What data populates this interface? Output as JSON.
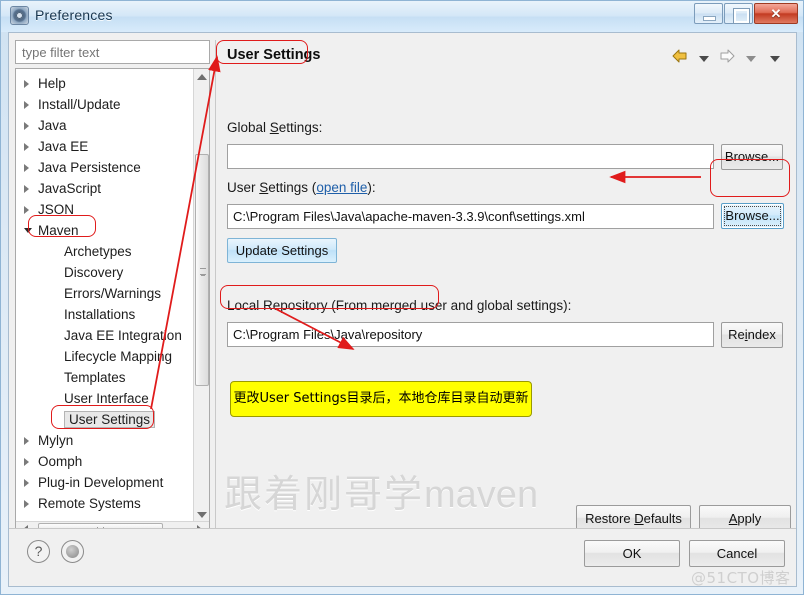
{
  "window": {
    "title": "Preferences",
    "icon": "gear-icon",
    "controls": {
      "minimize": "",
      "maximize": "",
      "close": "✕"
    }
  },
  "sidebar": {
    "filter_placeholder": "type filter text",
    "items": [
      {
        "label": "Help",
        "level": 0,
        "twisty": "closed"
      },
      {
        "label": "Install/Update",
        "level": 0,
        "twisty": "closed"
      },
      {
        "label": "Java",
        "level": 0,
        "twisty": "closed"
      },
      {
        "label": "Java EE",
        "level": 0,
        "twisty": "closed"
      },
      {
        "label": "Java Persistence",
        "level": 0,
        "twisty": "closed"
      },
      {
        "label": "JavaScript",
        "level": 0,
        "twisty": "closed"
      },
      {
        "label": "JSON",
        "level": 0,
        "twisty": "closed"
      },
      {
        "label": "Maven",
        "level": 0,
        "twisty": "open",
        "highlighted": true
      },
      {
        "label": "Archetypes",
        "level": 1,
        "twisty": "none"
      },
      {
        "label": "Discovery",
        "level": 1,
        "twisty": "none"
      },
      {
        "label": "Errors/Warnings",
        "level": 1,
        "twisty": "none"
      },
      {
        "label": "Installations",
        "level": 1,
        "twisty": "none"
      },
      {
        "label": "Java EE Integration",
        "level": 1,
        "twisty": "none"
      },
      {
        "label": "Lifecycle Mapping",
        "level": 1,
        "twisty": "none"
      },
      {
        "label": "Templates",
        "level": 1,
        "twisty": "none"
      },
      {
        "label": "User Interface",
        "level": 1,
        "twisty": "none"
      },
      {
        "label": "User Settings",
        "level": 1,
        "twisty": "none",
        "selected": true,
        "highlighted": true
      },
      {
        "label": "Mylyn",
        "level": 0,
        "twisty": "closed"
      },
      {
        "label": "Oomph",
        "level": 0,
        "twisty": "closed"
      },
      {
        "label": "Plug-in Development",
        "level": 0,
        "twisty": "closed"
      },
      {
        "label": "Remote Systems",
        "level": 0,
        "twisty": "closed"
      }
    ]
  },
  "content": {
    "page_title": "User Settings",
    "nav": {
      "back_icon": "back-arrow-icon",
      "back_dropdown_icon": "chevron-down-icon",
      "forward_icon": "forward-arrow-icon",
      "forward_dropdown_icon": "chevron-down-icon",
      "menu_dropdown_icon": "chevron-down-icon"
    },
    "global_settings": {
      "label": "Global Settings:",
      "label_pre": "Global ",
      "label_mnemonic": "S",
      "label_post": "ettings:",
      "value": "",
      "browse_label": "Browse..."
    },
    "user_settings": {
      "label_pre": "User ",
      "label_mnemonic": "S",
      "label_mid": "ettings (",
      "link": "open file",
      "label_post": "):",
      "value": "C:\\Program Files\\Java\\apache-maven-3.3.9\\conf\\settings.xml",
      "browse_label": "Browse...",
      "update_label": "Update Settings"
    },
    "local_repository": {
      "label": "Local Repository (From merged user and global settings):",
      "value": "C:\\Program Files\\Java\\repository",
      "reindex_pre": "Re",
      "reindex_mnemonic": "i",
      "reindex_post": "ndex"
    },
    "callout": "更改User Settings目录后，本地仓库目录自动更新",
    "watermark_cjk": "跟着刚哥学",
    "watermark_latin": "maven",
    "restore_defaults": {
      "pre": "Restore ",
      "mnemonic": "D",
      "post": "efaults"
    },
    "apply": {
      "mnemonic": "A",
      "post": "pply"
    }
  },
  "footer": {
    "help_icon": "question-mark-icon",
    "apply_close_icon": "apply-and-close-icon",
    "ok_label": "OK",
    "cancel_label": "Cancel",
    "site_watermark": "@51CTO博客"
  },
  "colors": {
    "annotation_red": "#e01b1b",
    "callout_yellow": "#ffff00",
    "link_blue": "#1f5fa9",
    "titlebar_blue": "#c6dff4"
  }
}
